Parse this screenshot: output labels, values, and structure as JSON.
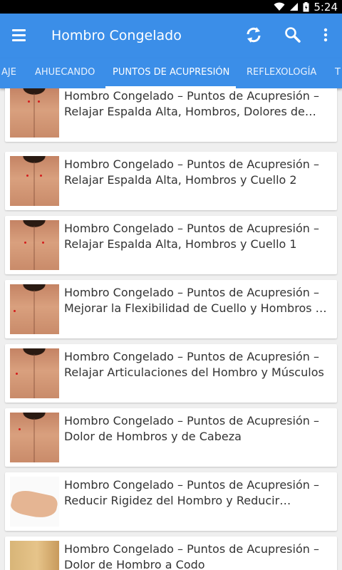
{
  "status_bar": {
    "time": "5:24"
  },
  "app_bar": {
    "title": "Hombro Congelado",
    "menu_icon": "menu-icon",
    "refresh_icon": "refresh-icon",
    "search_icon": "search-icon",
    "overflow_icon": "more-vert-icon",
    "accent": "#3b8ee8"
  },
  "tabs": [
    {
      "label": "AJE"
    },
    {
      "label": "AHUECANDO"
    },
    {
      "label": "PUNTOS DE ACUPRESIÓN",
      "active": true
    },
    {
      "label": "REFLEXOLOGÍA"
    },
    {
      "label": "T"
    }
  ],
  "articles": [
    {
      "line1": "Hombro Congelado – Puntos de Acupresión –",
      "line2": "Relajar Espalda Alta, Hombros, Dolores de…",
      "thumb": "back"
    },
    {
      "line1": "Hombro Congelado – Puntos de Acupresión –",
      "line2": "Relajar Espalda Alta, Hombros y Cuello 2",
      "thumb": "back"
    },
    {
      "line1": "Hombro Congelado – Puntos de Acupresión –",
      "line2": "Relajar Espalda Alta, Hombros y Cuello 1",
      "thumb": "back"
    },
    {
      "line1": "Hombro Congelado – Puntos de Acupresión –",
      "line2": "Mejorar la Flexibilidad de Cuello y Hombros y…",
      "thumb": "back"
    },
    {
      "line1": "Hombro Congelado – Puntos de Acupresión –",
      "line2": "Relajar Articulaciones del Hombro y Músculos",
      "thumb": "back"
    },
    {
      "line1": "Hombro Congelado – Puntos de Acupresión –",
      "line2": "Dolor de Hombros y de Cabeza",
      "thumb": "back"
    },
    {
      "line1": "Hombro Congelado – Puntos de Acupresión –",
      "line2": "Reducir Rigidez del Hombro y Reducir…",
      "thumb": "foot"
    },
    {
      "line1": "Hombro Congelado – Puntos de Acupresión –",
      "line2": "Dolor de Hombro a Codo",
      "thumb": "arm"
    }
  ]
}
